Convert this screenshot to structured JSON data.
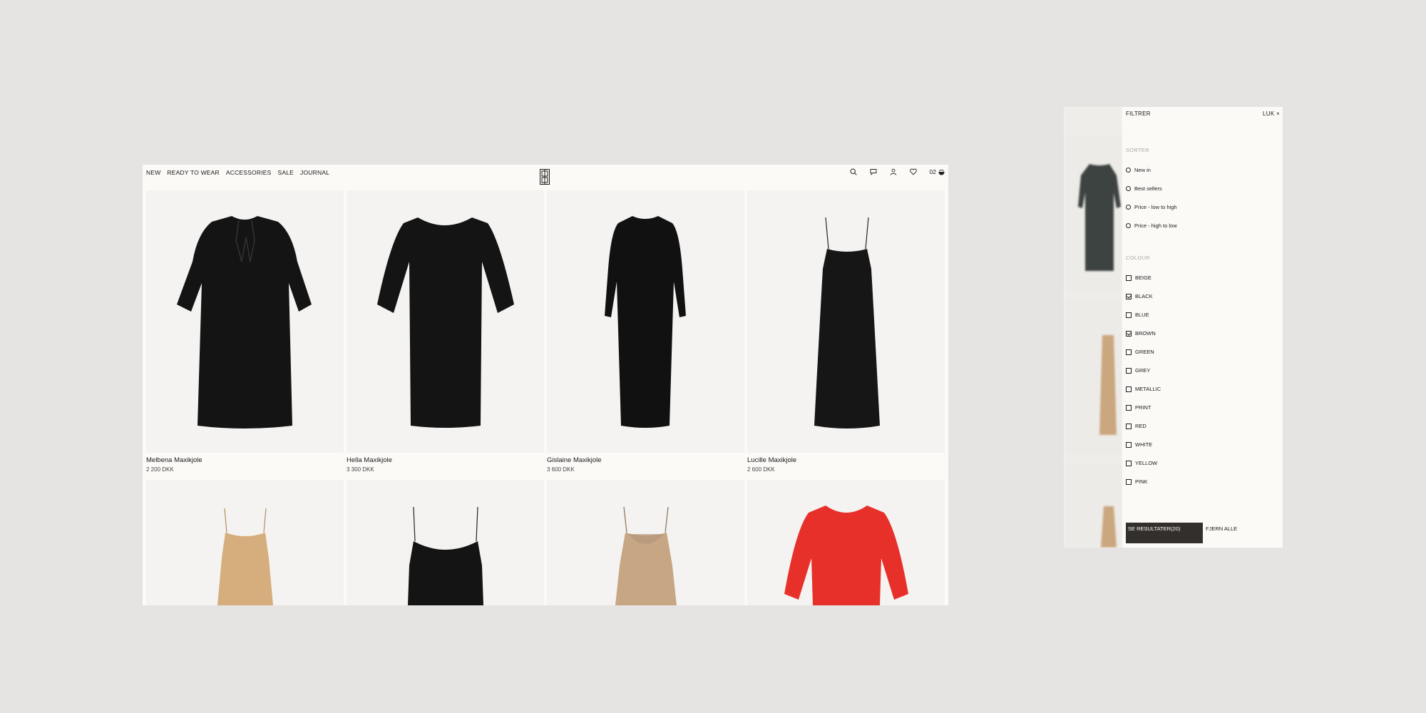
{
  "nav": {
    "links": [
      "NEW",
      "READY TO WEAR",
      "ACCESSORIES",
      "SALE",
      "JOURNAL"
    ],
    "bag_count": "02"
  },
  "products": [
    {
      "name": "Melbena Maxikjole",
      "price": "2 200 DKK",
      "color": "#141414"
    },
    {
      "name": "Hella Maxikjole",
      "price": "3 300 DKK",
      "color": "#141414"
    },
    {
      "name": "Gislaine Maxikjole",
      "price": "3 600 DKK",
      "color": "#111111"
    },
    {
      "name": "Lucille Maxikjole",
      "price": "2 600 DKK",
      "color": "#161616"
    },
    {
      "name": "",
      "price": "",
      "color": "#d6ad7c"
    },
    {
      "name": "",
      "price": "",
      "color": "#141414"
    },
    {
      "name": "",
      "price": "",
      "color": "#c7a684"
    },
    {
      "name": "",
      "price": "",
      "color": "#e8302b"
    }
  ],
  "filter": {
    "title": "FILTRER",
    "close": "LUK ×",
    "sort_heading": "SORTER",
    "sort_options": [
      "New in",
      "Best sellers",
      "Price - low to high",
      "Price - high to low"
    ],
    "colour_heading": "COLOUR",
    "colours": [
      {
        "label": "BEIGE",
        "checked": false
      },
      {
        "label": "BLACK",
        "checked": true
      },
      {
        "label": "BLUE",
        "checked": false
      },
      {
        "label": "BROWN",
        "checked": true
      },
      {
        "label": "GREEN",
        "checked": false
      },
      {
        "label": "GREY",
        "checked": false
      },
      {
        "label": "METALLIC",
        "checked": false
      },
      {
        "label": "PRINT",
        "checked": false
      },
      {
        "label": "RED",
        "checked": false
      },
      {
        "label": "WHITE",
        "checked": false
      },
      {
        "label": "YELLOW",
        "checked": false
      },
      {
        "label": "PINK",
        "checked": false
      }
    ],
    "see_results": "SE RESULTATER(20)",
    "clear_all": "FJERN ALLE"
  },
  "icons": [
    "search-icon",
    "chat-icon",
    "account-icon",
    "heart-icon",
    "bag-icon"
  ]
}
